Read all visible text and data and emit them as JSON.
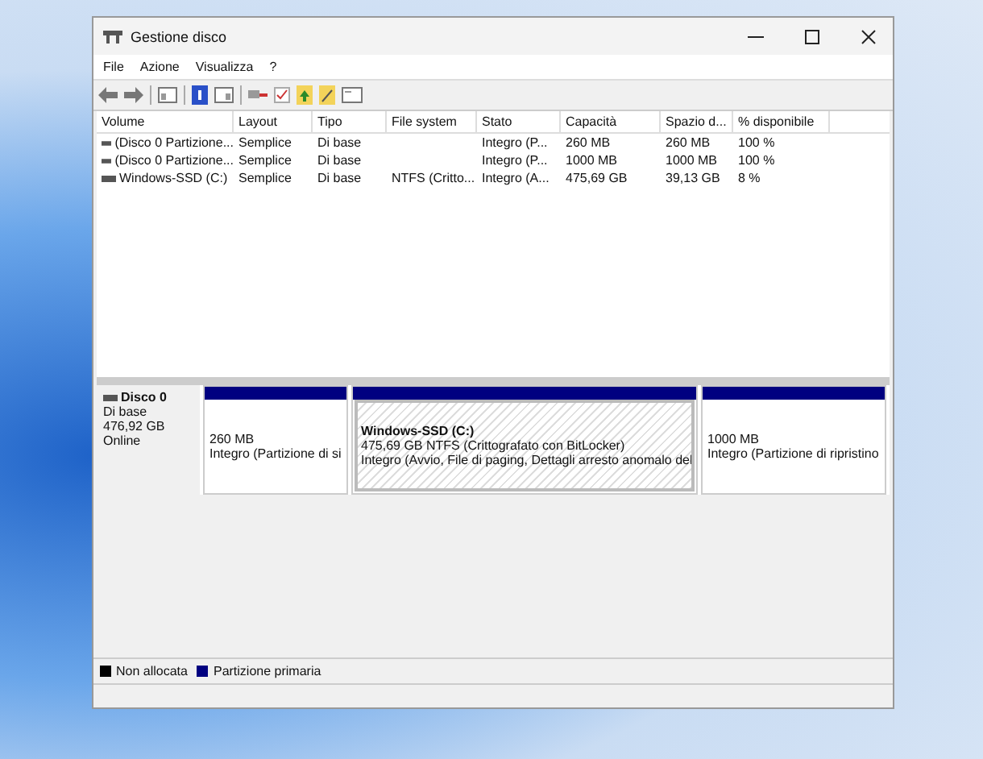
{
  "window": {
    "title": "Gestione disco"
  },
  "menu": [
    "File",
    "Azione",
    "Visualizza",
    "?"
  ],
  "table": {
    "columns": [
      "Volume",
      "Layout",
      "Tipo",
      "File system",
      "Stato",
      "Capacità",
      "Spazio d...",
      "% disponibile"
    ],
    "rows": [
      {
        "cells": [
          "(Disco 0 Partizione...",
          "Semplice",
          "Di base",
          "",
          "Integro (P...",
          "260 MB",
          "260 MB",
          "100 %"
        ]
      },
      {
        "cells": [
          "(Disco 0 Partizione...",
          "Semplice",
          "Di base",
          "",
          "Integro (P...",
          "1000 MB",
          "1000 MB",
          "100 %"
        ]
      },
      {
        "cells": [
          "Windows-SSD (C:)",
          "Semplice",
          "Di base",
          "NTFS (Critto...",
          "Integro (A...",
          "475,69 GB",
          "39,13 GB",
          "8 %"
        ]
      }
    ]
  },
  "disk": {
    "name": "Disco 0",
    "type": "Di base",
    "size": "476,92 GB",
    "status": "Online",
    "partitions": [
      {
        "size": "260 MB",
        "status": "Integro (Partizione di si",
        "selected": false
      },
      {
        "title": "Windows-SSD  (C:)",
        "size": "475,69 GB NTFS (Crittografato con BitLocker)",
        "status": "Integro (Avvio, File di paging, Dettagli arresto anomalo del",
        "selected": true
      },
      {
        "size": "1000 MB",
        "status": "Integro (Partizione di ripristino",
        "selected": false
      }
    ]
  },
  "legend": [
    {
      "label": "Non allocata",
      "color": "#000000"
    },
    {
      "label": "Partizione primaria",
      "color": "#000080"
    }
  ]
}
